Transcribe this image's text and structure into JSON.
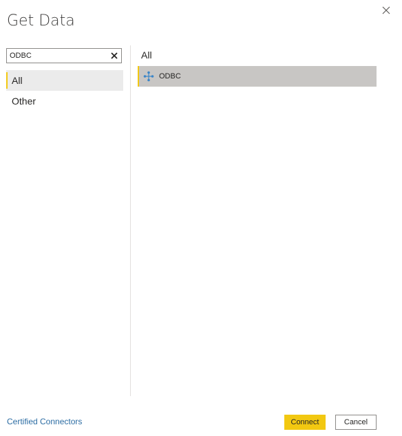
{
  "dialog": {
    "title": "Get Data",
    "close_icon": "close-icon"
  },
  "search": {
    "value": "ODBC",
    "clear_icon": "clear-icon"
  },
  "categories": [
    {
      "label": "All",
      "selected": true
    },
    {
      "label": "Other",
      "selected": false
    }
  ],
  "results": {
    "header": "All",
    "items": [
      {
        "label": "ODBC",
        "icon": "odbc-connector-icon",
        "selected": true
      }
    ]
  },
  "footer": {
    "certified_link": "Certified Connectors",
    "connect_label": "Connect",
    "cancel_label": "Cancel"
  },
  "colors": {
    "accent": "#f2c811",
    "link": "#2b6ca3",
    "selected_result_bg": "#c8c6c4",
    "selected_category_bg": "#ebebeb",
    "icon_blue": "#3c86c8"
  }
}
